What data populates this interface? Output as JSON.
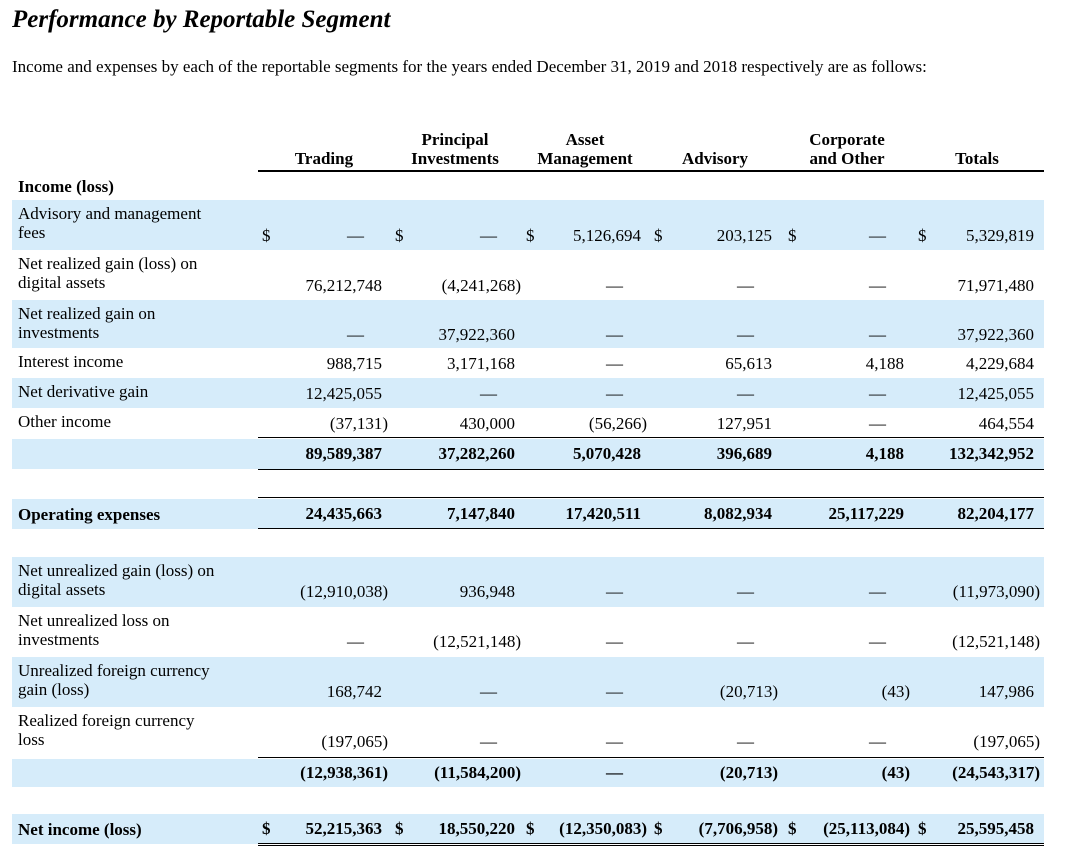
{
  "title": "Performance by Reportable Segment",
  "intro": "Income and expenses by each of the reportable segments for the years ended December 31, 2019 and 2018 respectively are as follows:",
  "columns": [
    "Trading",
    "Principal\nInvestments",
    "Asset\nManagement",
    "Advisory",
    "Corporate\nand Other",
    "Totals"
  ],
  "dash": "—",
  "dollar": "$",
  "sections": {
    "income_label": "Income (loss)",
    "income_rows": [
      {
        "label": "Advisory and management\nfees",
        "values": [
          "—",
          "—",
          "5,126,694",
          "203,125",
          "—",
          "5,329,819"
        ],
        "dollar": true
      },
      {
        "label": "Net realized gain (loss) on\ndigital assets",
        "values": [
          "76,212,748",
          "(4,241,268)",
          "—",
          "—",
          "—",
          "71,971,480"
        ]
      },
      {
        "label": "Net realized gain on\ninvestments",
        "values": [
          "—",
          "37,922,360",
          "—",
          "—",
          "—",
          "37,922,360"
        ]
      },
      {
        "label": "Interest income",
        "values": [
          "988,715",
          "3,171,168",
          "—",
          "65,613",
          "4,188",
          "4,229,684"
        ]
      },
      {
        "label": "Net derivative gain",
        "values": [
          "12,425,055",
          "—",
          "—",
          "—",
          "—",
          "12,425,055"
        ]
      },
      {
        "label": "Other income",
        "values": [
          "(37,131)",
          "430,000",
          "(56,266)",
          "127,951",
          "—",
          "464,554"
        ]
      }
    ],
    "income_total": [
      "89,589,387",
      "37,282,260",
      "5,070,428",
      "396,689",
      "4,188",
      "132,342,952"
    ],
    "opex_label": "Operating expenses",
    "opex_values": [
      "24,435,663",
      "7,147,840",
      "17,420,511",
      "8,082,934",
      "25,117,229",
      "82,204,177"
    ],
    "other_rows": [
      {
        "label": "Net unrealized gain (loss) on\ndigital assets",
        "values": [
          "(12,910,038)",
          "936,948",
          "—",
          "—",
          "—",
          "(11,973,090)"
        ]
      },
      {
        "label": "Net unrealized loss on\ninvestments",
        "values": [
          "—",
          "(12,521,148)",
          "—",
          "—",
          "—",
          "(12,521,148)"
        ]
      },
      {
        "label": "Unrealized foreign currency\ngain (loss)",
        "values": [
          "168,742",
          "—",
          "—",
          "(20,713)",
          "(43)",
          "147,986"
        ]
      },
      {
        "label": "Realized foreign currency\nloss",
        "values": [
          "(197,065)",
          "—",
          "—",
          "—",
          "—",
          "(197,065)"
        ]
      }
    ],
    "other_total": [
      "(12,938,361)",
      "(11,584,200)",
      "—",
      "(20,713)",
      "(43)",
      "(24,543,317)"
    ],
    "net_label": "Net income (loss)",
    "net_values": [
      "52,215,363",
      "18,550,220",
      "(12,350,083)",
      "(7,706,958)",
      "(25,113,084)",
      "25,595,458"
    ]
  }
}
